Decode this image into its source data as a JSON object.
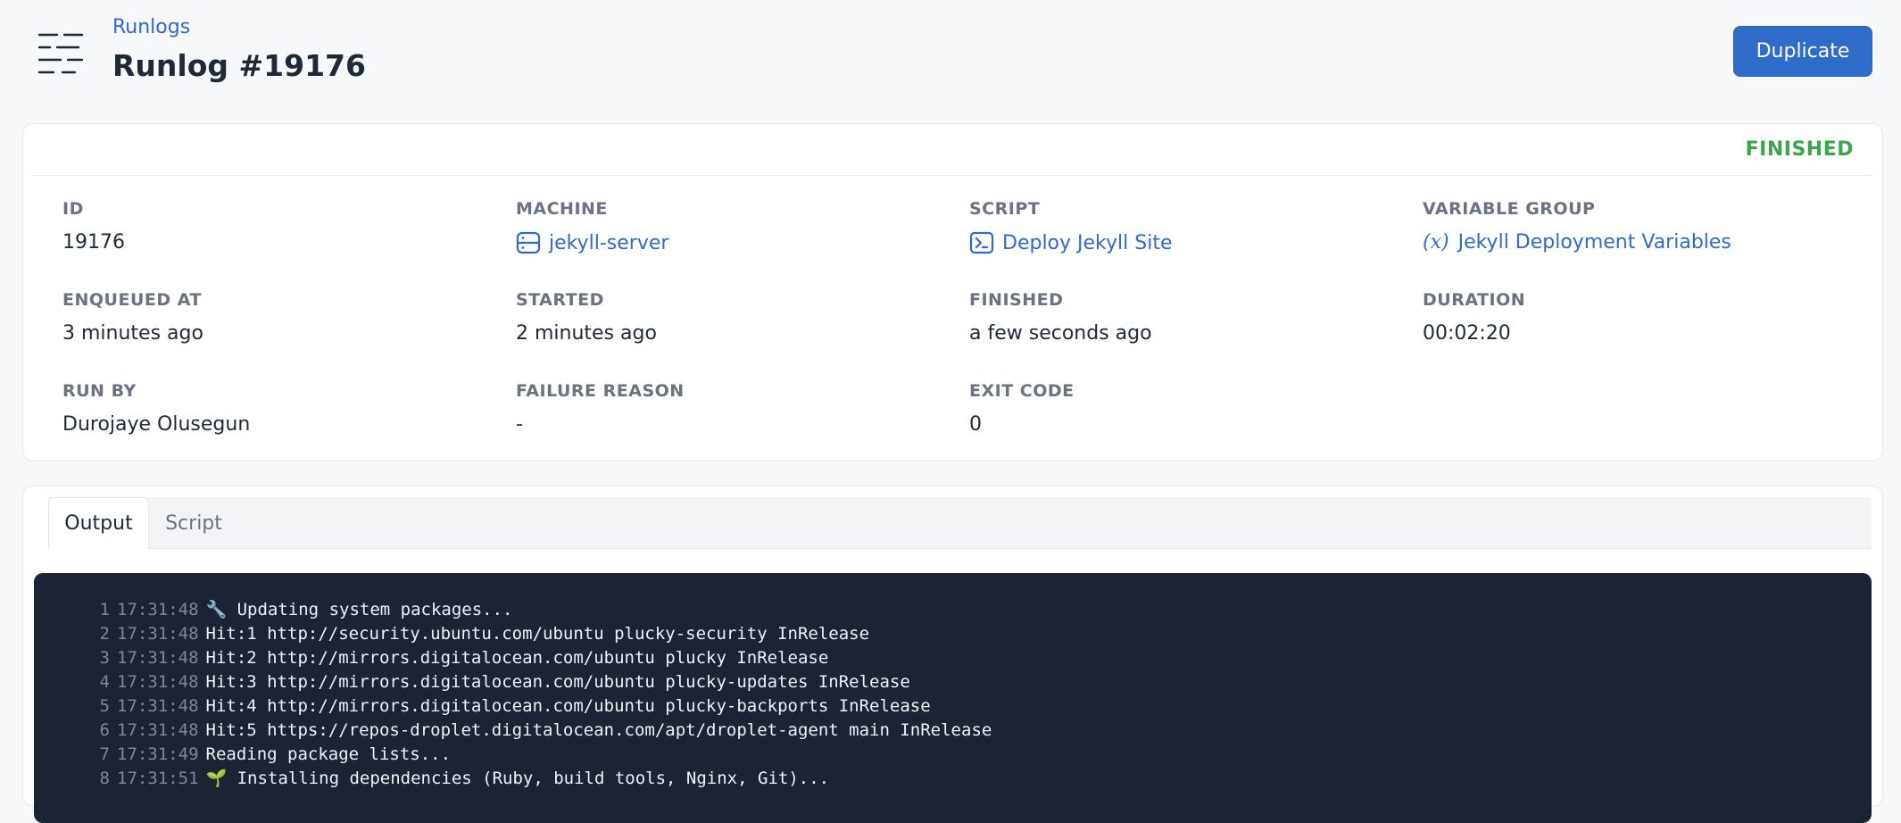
{
  "header": {
    "breadcrumb": "Runlogs",
    "title": "Runlog #19176",
    "duplicate_label": "Duplicate",
    "icon": "runlog-lines-icon"
  },
  "details": {
    "status": "FINISHED",
    "status_color": "#3fa54a",
    "fields": [
      {
        "label": "ID",
        "value": "19176"
      },
      {
        "label": "MACHINE",
        "value": "jekyll-server",
        "icon": "server-icon"
      },
      {
        "label": "SCRIPT",
        "value": "Deploy Jekyll Site",
        "icon": "terminal-icon"
      },
      {
        "label": "VARIABLE GROUP",
        "value": "Jekyll Deployment Variables",
        "icon": "variable-icon",
        "icon_glyph": "(x)"
      },
      {
        "label": "ENQUEUED AT",
        "value": "3 minutes ago"
      },
      {
        "label": "STARTED",
        "value": "2 minutes ago"
      },
      {
        "label": "FINISHED",
        "value": "a few seconds ago"
      },
      {
        "label": "DURATION",
        "value": "00:02:20"
      },
      {
        "label": "RUN BY",
        "value": "Durojaye Olusegun"
      },
      {
        "label": "FAILURE REASON",
        "value": "-"
      },
      {
        "label": "EXIT CODE",
        "value": "0"
      }
    ]
  },
  "output": {
    "tabs": [
      {
        "label": "Output",
        "active": true
      },
      {
        "label": "Script",
        "active": false
      }
    ],
    "lines": [
      {
        "num": "1",
        "time": "17:31:48",
        "text": "🔧 Updating system packages..."
      },
      {
        "num": "2",
        "time": "17:31:48",
        "text": "Hit:1 http://security.ubuntu.com/ubuntu plucky-security InRelease"
      },
      {
        "num": "3",
        "time": "17:31:48",
        "text": "Hit:2 http://mirrors.digitalocean.com/ubuntu plucky InRelease"
      },
      {
        "num": "4",
        "time": "17:31:48",
        "text": "Hit:3 http://mirrors.digitalocean.com/ubuntu plucky-updates InRelease"
      },
      {
        "num": "5",
        "time": "17:31:48",
        "text": "Hit:4 http://mirrors.digitalocean.com/ubuntu plucky-backports InRelease"
      },
      {
        "num": "6",
        "time": "17:31:48",
        "text": "Hit:5 https://repos-droplet.digitalocean.com/apt/droplet-agent main InRelease"
      },
      {
        "num": "7",
        "time": "17:31:49",
        "text": "Reading package lists..."
      },
      {
        "num": "8",
        "time": "17:31:51",
        "text": "🌱 Installing dependencies (Ruby, build tools, Nginx, Git)..."
      }
    ]
  },
  "colors": {
    "accent": "#2f6bc9",
    "terminal_bg": "#1c2433"
  }
}
